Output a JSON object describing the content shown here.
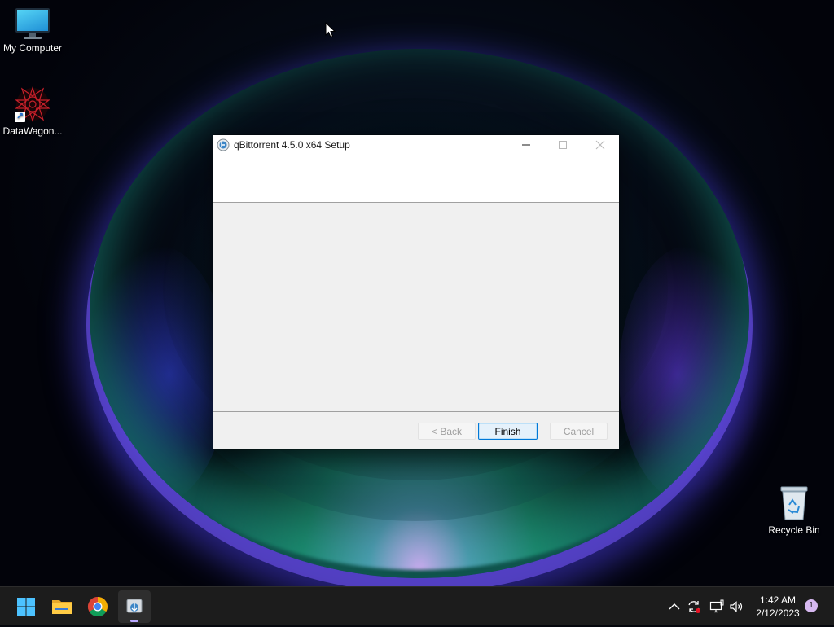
{
  "desktop": {
    "icons": [
      {
        "label": "My Computer",
        "icon": "monitor-icon"
      },
      {
        "label": "DataWagon...",
        "icon": "datawagon-shortcut-icon"
      },
      {
        "label": "Recycle Bin",
        "icon": "recycle-bin-icon"
      }
    ]
  },
  "window": {
    "title": "qBittorrent 4.5.0 x64 Setup",
    "buttons": {
      "back": "< Back",
      "finish": "Finish",
      "cancel": "Cancel"
    }
  },
  "taskbar": {
    "apps": [
      "windows-start-icon",
      "file-explorer-icon",
      "chrome-icon",
      "qbittorrent-setup-icon"
    ],
    "tray": [
      "chevron-up-icon",
      "sync-icon",
      "network-icon",
      "volume-icon"
    ],
    "clock": {
      "time": "1:42 AM",
      "date": "2/12/2023"
    },
    "notification_count": "1"
  },
  "colors": {
    "taskbar_bg": "#1c1c1c",
    "dialog_body_bg": "#f0f0f0",
    "accent_border": "#0078d7"
  }
}
